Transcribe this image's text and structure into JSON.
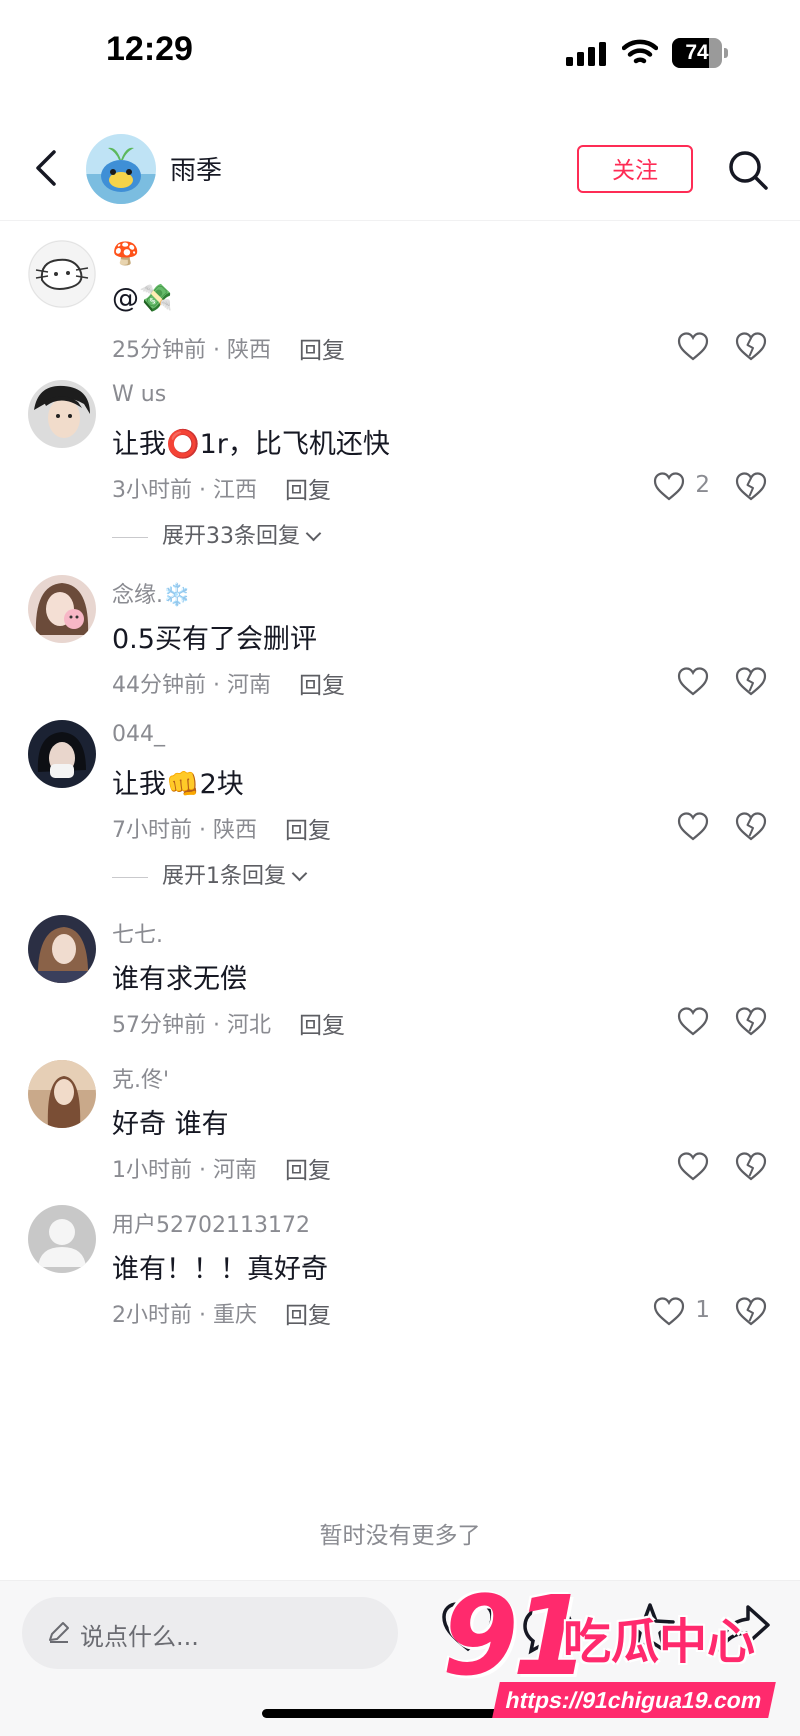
{
  "status_bar": {
    "time": "12:29",
    "battery": "74",
    "battery_level": 0.74
  },
  "header": {
    "username": "雨季",
    "follow_label": "关注"
  },
  "comments": [
    {
      "username": "🍄",
      "text": "@💸",
      "time_location": "25分钟前 · 陕西",
      "reply_label": "回复",
      "likes": ""
    },
    {
      "username": "W us",
      "text": "让我⭕1r，比飞机还快",
      "time_location": "3小时前 · 江西",
      "reply_label": "回复",
      "likes": "2",
      "expand": "展开33条回复"
    },
    {
      "username": "念缘.❄️",
      "text": "0.5买有了会删评",
      "time_location": "44分钟前 · 河南",
      "reply_label": "回复",
      "likes": ""
    },
    {
      "username": "044_",
      "text": "让我👊2块",
      "time_location": "7小时前 · 陕西",
      "reply_label": "回复",
      "likes": "",
      "expand": "展开1条回复"
    },
    {
      "username": "七七.",
      "text": "谁有求无偿",
      "time_location": "57分钟前 · 河北",
      "reply_label": "回复",
      "likes": ""
    },
    {
      "username": "克.佟'",
      "text": "好奇 谁有",
      "time_location": "1小时前 · 河南",
      "reply_label": "回复",
      "likes": ""
    },
    {
      "username": "用户52702113172",
      "text": "谁有！！！真好奇",
      "time_location": "2小时前 · 重庆",
      "reply_label": "回复",
      "likes": "1"
    }
  ],
  "footer": {
    "no_more": "暂时没有更多了",
    "input_placeholder": "说点什么..."
  },
  "watermark": {
    "logo": "91",
    "name": "吃瓜中心",
    "url": "https://91chigua19.com"
  },
  "colors": {
    "accent": "#fe2c55",
    "watermark": "#ff2a6d"
  },
  "icons": [
    "back-arrow-icon",
    "search-icon",
    "heart-icon",
    "broken-heart-icon",
    "pen-icon",
    "star-icon",
    "share-icon"
  ]
}
